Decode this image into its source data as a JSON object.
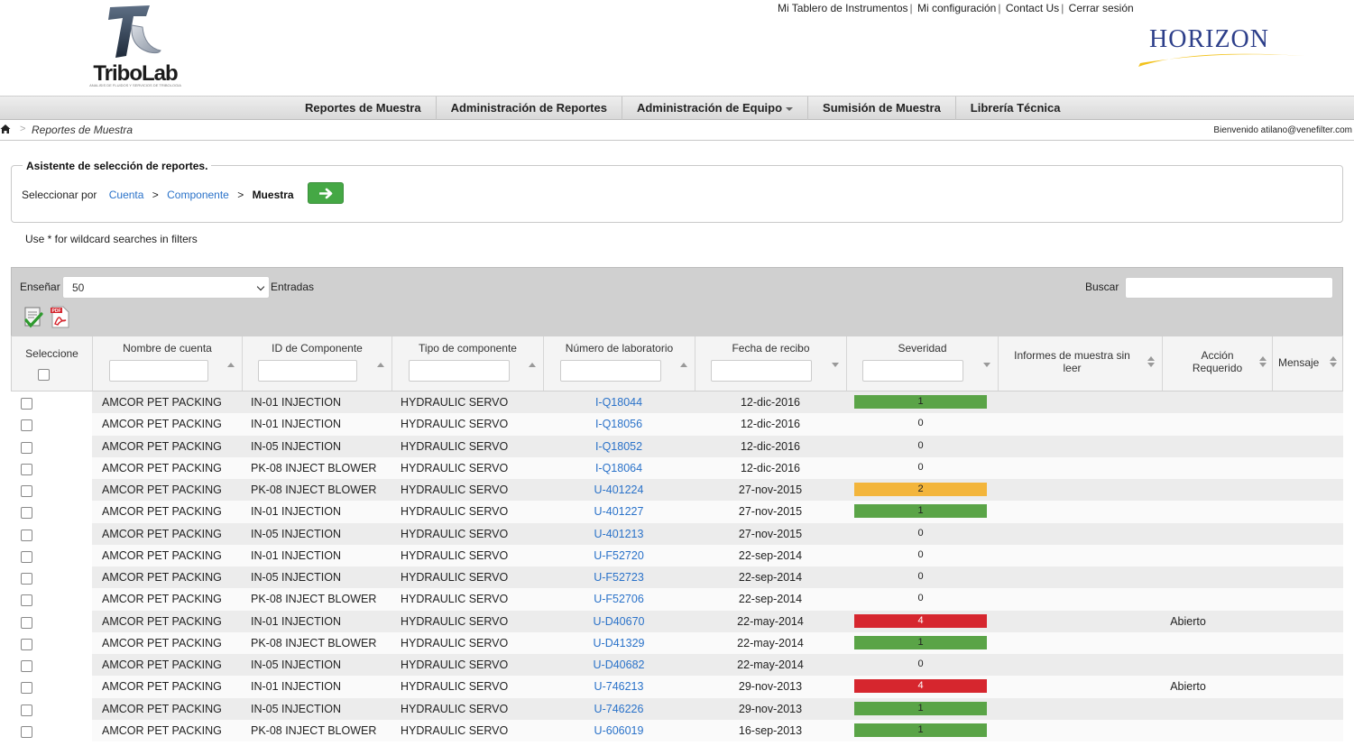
{
  "header": {
    "logo_text": "TriboLab",
    "logo_subtitle": "ANALISIS DE FLUIDOS Y SERVICIOS DE TRIBOLOGIA",
    "top_links": [
      "Mi Tablero de Instrumentos",
      "Mi configuración",
      "Contact Us",
      "Cerrar sesión"
    ],
    "brand_text": "HORIZON"
  },
  "nav": {
    "items": [
      "Reportes de Muestra",
      "Administración de Reportes",
      "Administración de Equipo",
      "Sumisión de Muestra",
      "Librería Técnica"
    ]
  },
  "breadcrumb": {
    "separator": ">",
    "current": "Reportes de Muestra",
    "welcome": "Bienvenido atilano@venefilter.com"
  },
  "wizard": {
    "legend": "Asistente de selección de reportes.",
    "select_by": "Seleccionar por",
    "step_account": "Cuenta",
    "step_component": "Componente",
    "step_sample": "Muestra",
    "separator": ">"
  },
  "hint": "Use * for wildcard searches in filters",
  "table_controls": {
    "show_label": "Enseñar",
    "show_value": "50",
    "entries_label": "Entradas",
    "search_label": "Buscar"
  },
  "columns": {
    "select": "Seleccione",
    "account": "Nombre de cuenta",
    "component_id": "ID de Componente",
    "component_type": "Tipo de componente",
    "lab_number": "Número de laboratorio",
    "receipt_date": "Fecha de recibo",
    "severity": "Severidad",
    "unread": "Informes de muestra sin leer",
    "action": "Acción Requerido",
    "message": "Mensaje"
  },
  "colors": {
    "severity_1": "#5aa447",
    "severity_2": "#f3b53b",
    "severity_4": "#d6262e",
    "link": "#2a72c9",
    "go_button": "#45a845"
  },
  "rows": [
    {
      "account": "AMCOR PET PACKING",
      "component_id": "IN-01 INJECTION",
      "component_type": "HYDRAULIC SERVO",
      "lab_number": "I-Q18044",
      "receipt_date": "12-dic-2016",
      "severity": "1",
      "action": ""
    },
    {
      "account": "AMCOR PET PACKING",
      "component_id": "IN-01 INJECTION",
      "component_type": "HYDRAULIC SERVO",
      "lab_number": "I-Q18056",
      "receipt_date": "12-dic-2016",
      "severity": "0",
      "action": ""
    },
    {
      "account": "AMCOR PET PACKING",
      "component_id": "IN-05 INJECTION",
      "component_type": "HYDRAULIC SERVO",
      "lab_number": "I-Q18052",
      "receipt_date": "12-dic-2016",
      "severity": "0",
      "action": ""
    },
    {
      "account": "AMCOR PET PACKING",
      "component_id": "PK-08 INJECT BLOWER",
      "component_type": "HYDRAULIC SERVO",
      "lab_number": "I-Q18064",
      "receipt_date": "12-dic-2016",
      "severity": "0",
      "action": ""
    },
    {
      "account": "AMCOR PET PACKING",
      "component_id": "PK-08 INJECT BLOWER",
      "component_type": "HYDRAULIC SERVO",
      "lab_number": "U-401224",
      "receipt_date": "27-nov-2015",
      "severity": "2",
      "action": ""
    },
    {
      "account": "AMCOR PET PACKING",
      "component_id": "IN-01 INJECTION",
      "component_type": "HYDRAULIC SERVO",
      "lab_number": "U-401227",
      "receipt_date": "27-nov-2015",
      "severity": "1",
      "action": ""
    },
    {
      "account": "AMCOR PET PACKING",
      "component_id": "IN-05 INJECTION",
      "component_type": "HYDRAULIC SERVO",
      "lab_number": "U-401213",
      "receipt_date": "27-nov-2015",
      "severity": "0",
      "action": ""
    },
    {
      "account": "AMCOR PET PACKING",
      "component_id": "IN-01 INJECTION",
      "component_type": "HYDRAULIC SERVO",
      "lab_number": "U-F52720",
      "receipt_date": "22-sep-2014",
      "severity": "0",
      "action": ""
    },
    {
      "account": "AMCOR PET PACKING",
      "component_id": "IN-05 INJECTION",
      "component_type": "HYDRAULIC SERVO",
      "lab_number": "U-F52723",
      "receipt_date": "22-sep-2014",
      "severity": "0",
      "action": ""
    },
    {
      "account": "AMCOR PET PACKING",
      "component_id": "PK-08 INJECT BLOWER",
      "component_type": "HYDRAULIC SERVO",
      "lab_number": "U-F52706",
      "receipt_date": "22-sep-2014",
      "severity": "0",
      "action": ""
    },
    {
      "account": "AMCOR PET PACKING",
      "component_id": "IN-01 INJECTION",
      "component_type": "HYDRAULIC SERVO",
      "lab_number": "U-D40670",
      "receipt_date": "22-may-2014",
      "severity": "4",
      "action": "Abierto"
    },
    {
      "account": "AMCOR PET PACKING",
      "component_id": "PK-08 INJECT BLOWER",
      "component_type": "HYDRAULIC SERVO",
      "lab_number": "U-D41329",
      "receipt_date": "22-may-2014",
      "severity": "1",
      "action": ""
    },
    {
      "account": "AMCOR PET PACKING",
      "component_id": "IN-05 INJECTION",
      "component_type": "HYDRAULIC SERVO",
      "lab_number": "U-D40682",
      "receipt_date": "22-may-2014",
      "severity": "0",
      "action": ""
    },
    {
      "account": "AMCOR PET PACKING",
      "component_id": "IN-01 INJECTION",
      "component_type": "HYDRAULIC SERVO",
      "lab_number": "U-746213",
      "receipt_date": "29-nov-2013",
      "severity": "4",
      "action": "Abierto"
    },
    {
      "account": "AMCOR PET PACKING",
      "component_id": "IN-05 INJECTION",
      "component_type": "HYDRAULIC SERVO",
      "lab_number": "U-746226",
      "receipt_date": "29-nov-2013",
      "severity": "1",
      "action": ""
    },
    {
      "account": "AMCOR PET PACKING",
      "component_id": "PK-08 INJECT BLOWER",
      "component_type": "HYDRAULIC SERVO",
      "lab_number": "U-606019",
      "receipt_date": "16-sep-2013",
      "severity": "1",
      "action": ""
    }
  ]
}
